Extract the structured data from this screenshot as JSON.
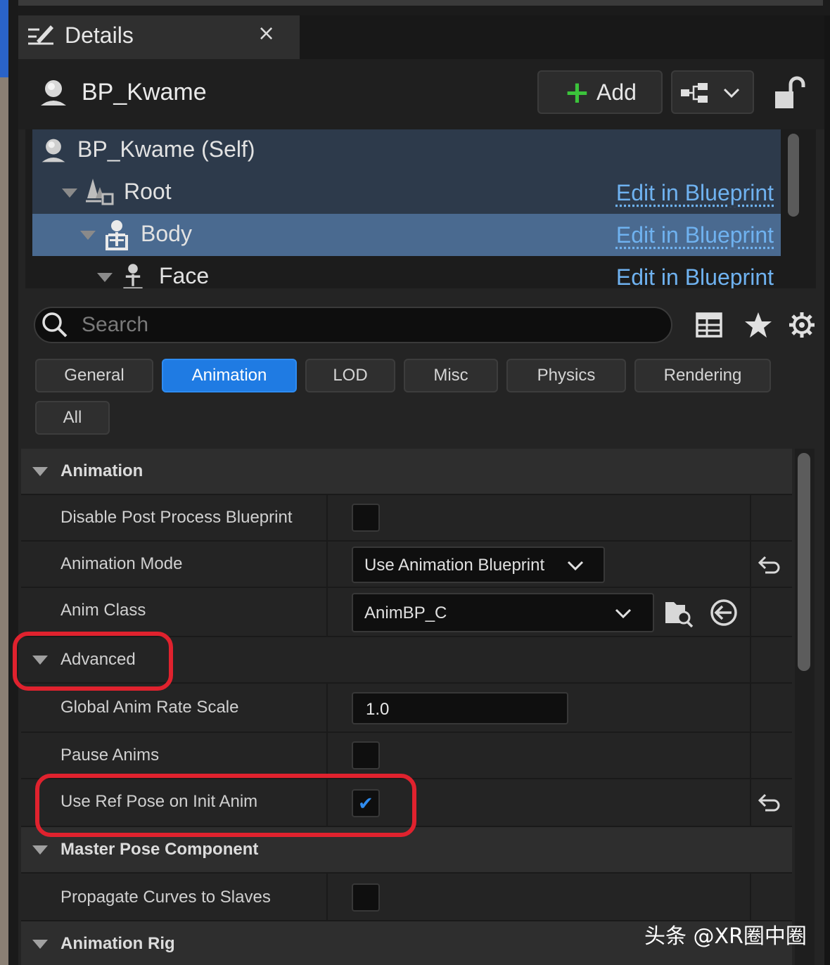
{
  "panel": {
    "tab_title": "Details",
    "close_glyph": "×"
  },
  "actor": {
    "name": "BP_Kwame",
    "add_label": "Add"
  },
  "component_tree": [
    {
      "label": "BP_Kwame (Self)",
      "edit": ""
    },
    {
      "label": "Root",
      "edit": "Edit in Blueprint"
    },
    {
      "label": "Body",
      "edit": "Edit in Blueprint"
    },
    {
      "label": "Face",
      "edit": "Edit in Blueprint"
    }
  ],
  "search": {
    "placeholder": "Search"
  },
  "categories": [
    "General",
    "Animation",
    "LOD",
    "Misc",
    "Physics",
    "Rendering",
    "All"
  ],
  "active_category": "Animation",
  "sections": {
    "animation": "Animation",
    "advanced": "Advanced",
    "master_pose": "Master Pose Component",
    "animation_rig": "Animation Rig"
  },
  "properties": {
    "disable_post_process": {
      "label": "Disable Post Process Blueprint",
      "checked": false
    },
    "animation_mode": {
      "label": "Animation Mode",
      "value": "Use Animation Blueprint"
    },
    "anim_class": {
      "label": "Anim Class",
      "value": "AnimBP_C"
    },
    "global_anim_rate": {
      "label": "Global Anim Rate Scale",
      "value": "1.0"
    },
    "pause_anims": {
      "label": "Pause Anims",
      "checked": false
    },
    "use_ref_pose": {
      "label": "Use Ref Pose on Init Anim",
      "checked": true
    },
    "propagate_curves": {
      "label": "Propagate Curves to Slaves",
      "checked": false
    }
  },
  "watermark": "头条 @XR圈中圈",
  "colors": {
    "accent_blue": "#1f7be3",
    "link_blue": "#6fb2f0",
    "add_green": "#3bc33b",
    "highlight_red": "#e0222e",
    "selected_row": "#4a6a90"
  }
}
